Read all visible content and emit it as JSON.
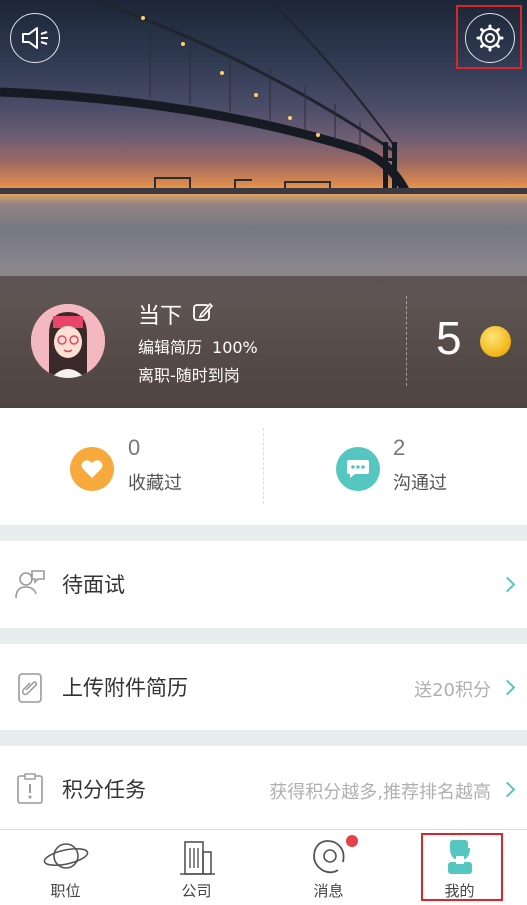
{
  "profile": {
    "name": "当下",
    "resume_label": "编辑简历",
    "resume_completion": "100%",
    "status": "离职-随时到岗",
    "points": "5"
  },
  "stats": [
    {
      "count": "0",
      "label": "收藏过",
      "icon": "heart-icon",
      "color": "#f7a93b"
    },
    {
      "count": "2",
      "label": "沟通过",
      "icon": "chat-bubble-icon",
      "color": "#55c6c0"
    }
  ],
  "menu": [
    {
      "label": "待面试",
      "hint": "",
      "icon": "interview-people-icon"
    },
    {
      "label": "上传附件简历",
      "hint": "送20积分",
      "icon": "attachment-clip-icon"
    },
    {
      "label": "积分任务",
      "hint": "获得积分越多,推荐排名越高",
      "icon": "task-board-icon"
    }
  ],
  "tabs": [
    {
      "label": "职位",
      "icon": "planet-icon"
    },
    {
      "label": "公司",
      "icon": "building-icon"
    },
    {
      "label": "消息",
      "icon": "message-at-icon"
    },
    {
      "label": "我的",
      "icon": "profile-icon"
    }
  ],
  "colors": {
    "accent": "#55c6c0",
    "favorite": "#f7a93b",
    "badge": "#e8404a",
    "highlight": "#d8262b"
  }
}
